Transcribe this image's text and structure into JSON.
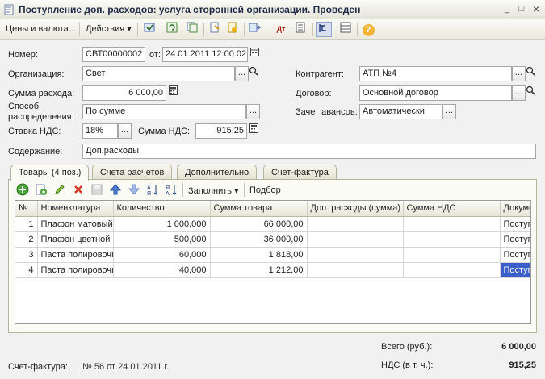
{
  "window": {
    "title": "Поступление доп. расходов: услуга сторонней организации. Проведен",
    "buttons": {
      "minimize": "_",
      "maximize": "□",
      "close": "×"
    }
  },
  "toolbar": {
    "prices_label": "Цены и валюта...",
    "actions_label": "Действия",
    "dropdown_glyph": "▾",
    "help_glyph": "?"
  },
  "form": {
    "number_label": "Номер:",
    "number_value": "СВТ00000002",
    "date_label": "от:",
    "date_value": "24.01.2011 12:00:02",
    "organization_label": "Организация:",
    "organization_value": "Свет",
    "counterparty_label": "Контрагент:",
    "counterparty_value": "АТП №4",
    "amount_label": "Сумма расхода:",
    "amount_value": "6 000,00",
    "contract_label": "Договор:",
    "contract_value": "Основной договор",
    "distribution_label_1": "Способ",
    "distribution_label_2": "распределения:",
    "distribution_value": "По сумме",
    "advance_label": "Зачет авансов:",
    "advance_value": "Автоматически",
    "vat_rate_label": "Ставка НДС:",
    "vat_rate_value": "18%",
    "vat_amount_label": "Сумма НДС:",
    "vat_amount_value": "915,25",
    "content_label": "Содержание:",
    "content_value": "Доп.расходы",
    "ellipsis": "...",
    "search_glyph": "⌕"
  },
  "tabs": [
    {
      "label": "Товары (4 поз.)"
    },
    {
      "label": "Счета расчетов"
    },
    {
      "label": "Дополнительно"
    },
    {
      "label": "Счет-фактура"
    }
  ],
  "grid_toolbar": {
    "fill_label": "Заполнить",
    "select_label": "Подбор"
  },
  "table": {
    "columns": [
      "№",
      "Номенклатура",
      "Количество",
      "Сумма товара",
      "Доп. расходы (сумма)",
      "Сумма НДС",
      "Документ"
    ],
    "rows": [
      [
        "1",
        "Плафон матовый",
        "1 000,000",
        "66 000,00",
        "",
        "",
        "Поступ"
      ],
      [
        "2",
        "Плафон цветной",
        "500,000",
        "36 000,00",
        "",
        "",
        "Поступ"
      ],
      [
        "3",
        "Паста полировочная",
        "60,000",
        "1 818,00",
        "",
        "",
        "Поступ"
      ],
      [
        "4",
        "Паста полировочная",
        "40,000",
        "1 212,00",
        "",
        "",
        "Поступ"
      ]
    ]
  },
  "footer": {
    "total_label": "Всего (руб.):",
    "total_value": "6 000,00",
    "vat_incl_label": "НДС (в т. ч.):",
    "vat_incl_value": "915,25",
    "invoice_label": "Счет-фактура:",
    "invoice_value": "№ 56 от 24.01.2011 г."
  },
  "colors": {
    "accent": "#3a5fc8",
    "titlebar": "#e4e4da",
    "panel": "#f1f1f1"
  }
}
